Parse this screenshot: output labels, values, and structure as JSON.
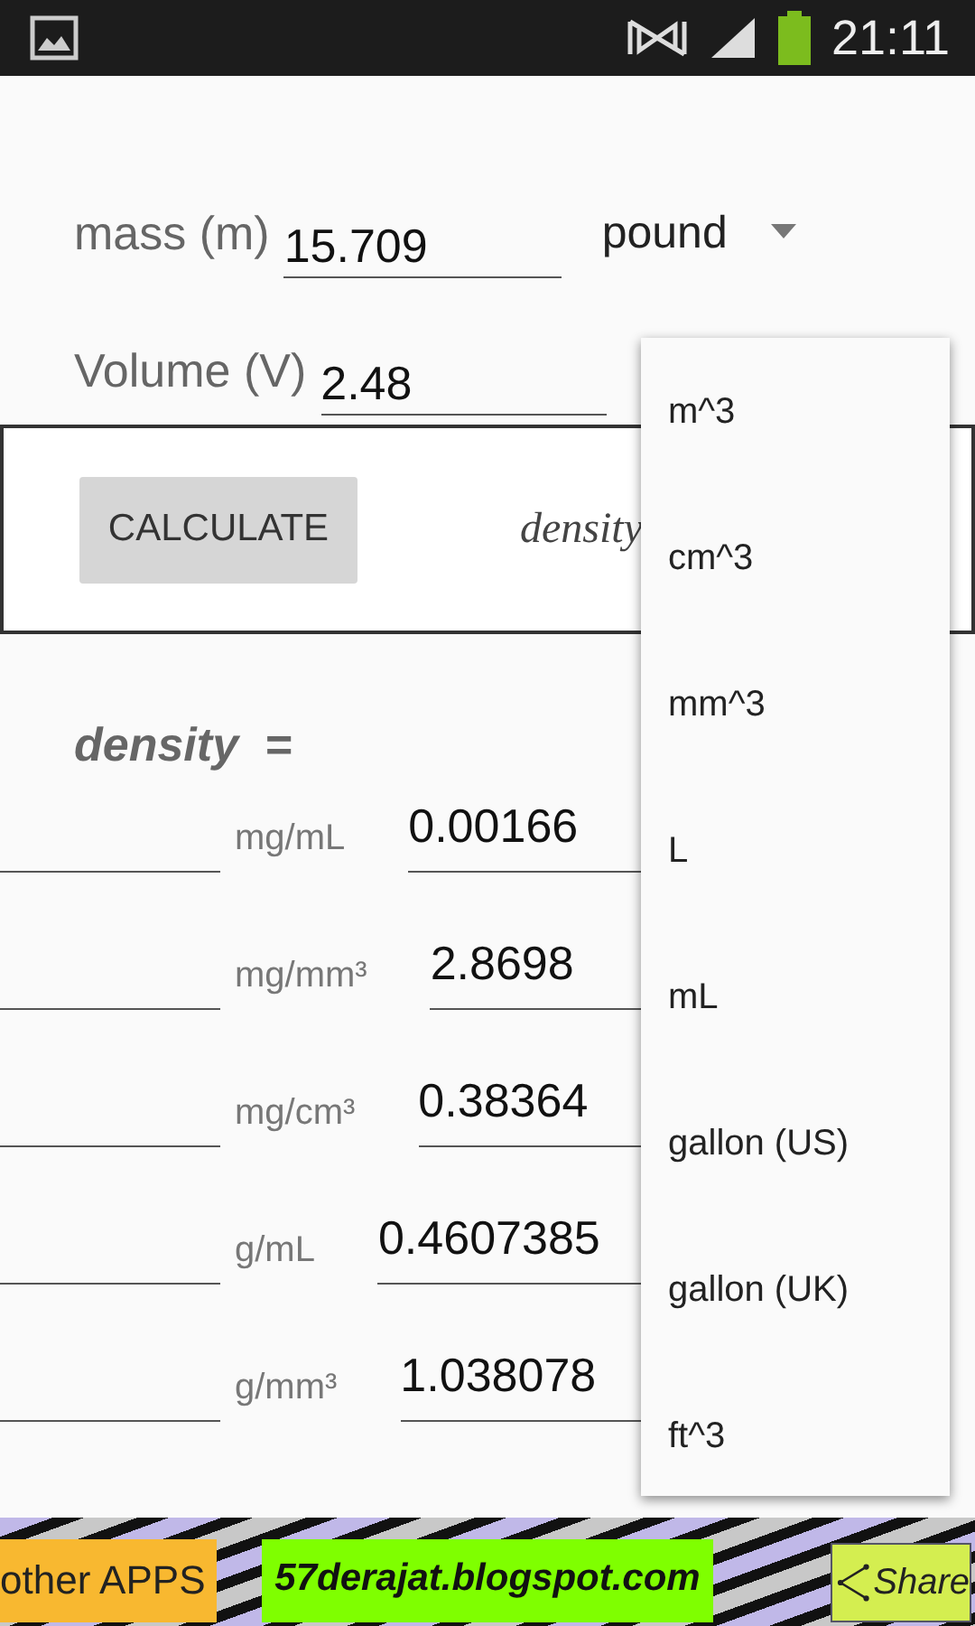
{
  "status_bar": {
    "time": "21:11"
  },
  "inputs": [
    {
      "label": "mass (m)",
      "value": "15.709",
      "unit": "pound"
    },
    {
      "label": "Volume (V)",
      "value": "2.48"
    }
  ],
  "calculate_button": "CALCULATE",
  "formula_label": "density",
  "result_heading": "density  =",
  "results": [
    {
      "unit": "mg/mL",
      "value": "0.00166"
    },
    {
      "unit": "mg/mm³",
      "value": "2.8698"
    },
    {
      "unit": "mg/cm³",
      "value": "0.38364"
    },
    {
      "unit": "g/mL",
      "value": "0.4607385"
    },
    {
      "unit": "g/mm³",
      "value": "1.038078"
    }
  ],
  "unit_menu": {
    "items": [
      "m^3",
      "cm^3",
      "mm^3",
      "L",
      "mL",
      "gallon (US)",
      "gallon (UK)",
      "ft^3"
    ]
  },
  "footer": {
    "other_apps": "other APPS",
    "site": "57derajat.blogspot.com",
    "share": "Share"
  }
}
